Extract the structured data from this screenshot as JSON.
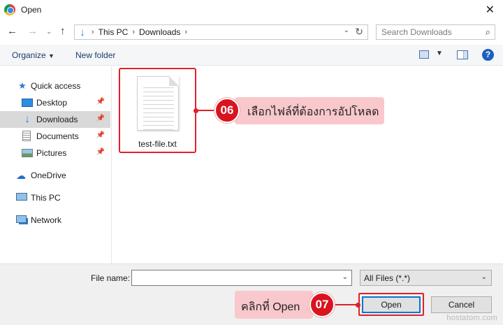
{
  "window": {
    "title": "Open"
  },
  "address": {
    "crumbs": [
      "This PC",
      "Downloads"
    ]
  },
  "search": {
    "placeholder": "Search Downloads"
  },
  "toolbar": {
    "organize": "Organize",
    "new_folder": "New folder"
  },
  "sidebar": {
    "items": [
      {
        "label": "Quick access",
        "icon": "star-icon"
      },
      {
        "label": "Desktop",
        "icon": "desktop-icon",
        "pinned": true
      },
      {
        "label": "Downloads",
        "icon": "download-arrow-icon",
        "pinned": true,
        "selected": true
      },
      {
        "label": "Documents",
        "icon": "document-icon",
        "pinned": true
      },
      {
        "label": "Pictures",
        "icon": "picture-icon",
        "pinned": true
      },
      {
        "label": "OneDrive",
        "icon": "cloud-icon"
      },
      {
        "label": "This PC",
        "icon": "computer-icon"
      },
      {
        "label": "Network",
        "icon": "network-icon"
      }
    ]
  },
  "files": [
    {
      "name": "test-file.txt",
      "icon": "text-file-icon"
    }
  ],
  "callouts": {
    "step6": {
      "number": "06",
      "text": "เลือกไฟล์ที่ต้องการอัปโหลด"
    },
    "step7": {
      "number": "07",
      "text": "คลิกที่ Open"
    }
  },
  "bottom": {
    "file_name_label": "File name:",
    "file_name_value": "",
    "filter_value": "All Files (*.*)",
    "open_label": "Open",
    "cancel_label": "Cancel"
  },
  "watermark": "hostatom.com",
  "colors": {
    "accent_red": "#e0202a",
    "callout_bg": "#f9c8cc",
    "link_blue": "#1a3b6b"
  }
}
